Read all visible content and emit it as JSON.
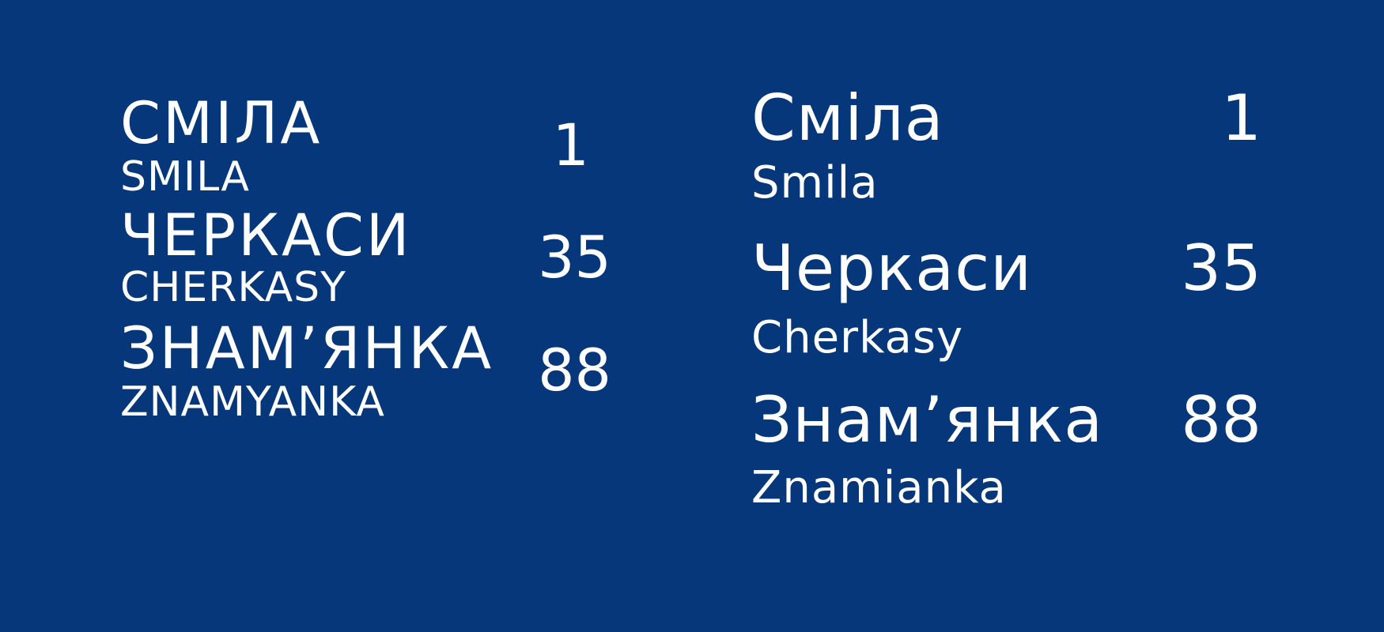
{
  "colors": {
    "background": "#05377a",
    "text": "#ffffff"
  },
  "left_panel": {
    "rows": [
      {
        "name": "СМІЛА",
        "latin": "SMILA",
        "distance": "1"
      },
      {
        "name": "ЧЕРКАСИ",
        "latin": "CHERKASY",
        "distance": "35"
      },
      {
        "name": "ЗНАМ’ЯНКА",
        "latin": "ZNAMYANKA",
        "distance": "88"
      }
    ]
  },
  "right_panel": {
    "rows": [
      {
        "name": "Сміла",
        "latin": "Smila",
        "distance": "1"
      },
      {
        "name": "Черкаси",
        "latin": "Cherkasy",
        "distance": "35"
      },
      {
        "name": "Знам’янка",
        "latin": "Znamianka",
        "distance": "88"
      }
    ]
  }
}
